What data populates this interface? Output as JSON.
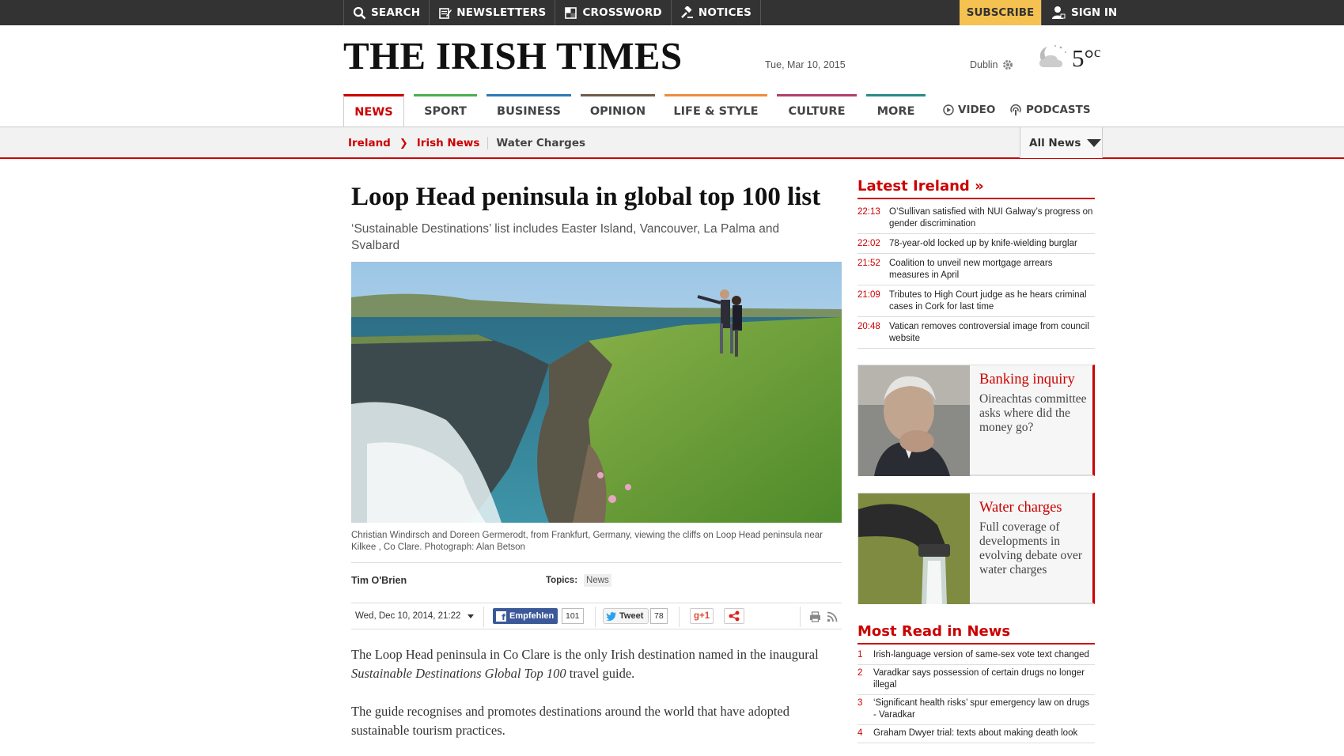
{
  "topbar": {
    "search": "SEARCH",
    "newsletters": "NEWSLETTERS",
    "crossword": "CROSSWORD",
    "notices": "NOTICES",
    "subscribe": "SUBSCRIBE",
    "signin": "SIGN IN"
  },
  "masthead": {
    "logo": "THE IRISH TIMES",
    "date": "Tue, Mar 10, 2015",
    "city": "Dublin",
    "temp": "5°",
    "temp_unit": "c"
  },
  "nav": {
    "sections": [
      {
        "label": "NEWS",
        "color": "#cc0000"
      },
      {
        "label": "SPORT",
        "color": "#4caf50"
      },
      {
        "label": "BUSINESS",
        "color": "#2b7bb9"
      },
      {
        "label": "OPINION",
        "color": "#6d5c4b"
      },
      {
        "label": "LIFE & STYLE",
        "color": "#f08c3c"
      },
      {
        "label": "CULTURE",
        "color": "#b0406e"
      },
      {
        "label": "MORE",
        "color": "#2a8a8a"
      }
    ],
    "video": "VIDEO",
    "podcasts": "PODCASTS"
  },
  "breadcrumb": {
    "level1": "Ireland",
    "level2": "Irish News",
    "current": "Water Charges",
    "all_news": "All News"
  },
  "article": {
    "headline": "Loop Head peninsula in global top 100 list",
    "standfirst": "‘Sustainable Destinations’ list includes Easter Island, Vancouver, La Palma and Svalbard",
    "caption": "Christian Windirsch and Doreen Germerodt, from Frankfurt, Germany, viewing the cliffs on Loop Head peninsula near Kilkee , Co Clare. Photograph: Alan Betson",
    "author": "Tim O'Brien",
    "topics_label": "Topics:",
    "topic": "News",
    "published": "Wed, Dec 10, 2014, 21:22",
    "fb_label": "Empfehlen",
    "fb_count": "101",
    "tweet_label": "Tweet",
    "tweet_count": "78",
    "gplus": "g+1",
    "para1_a": "The Loop Head peninsula in Co Clare is the only Irish destination named in the inaugural ",
    "para1_em": "Sustainable Destinations Global Top 100",
    "para1_b": " travel guide.",
    "para2": "The guide recognises and promotes destinations around the world that have adopted sustainable tourism practices."
  },
  "sidebar": {
    "latest_title": "Latest Ireland »",
    "latest": [
      {
        "time": "22:13",
        "text": "O’Sullivan satisfied with NUI Galway’s progress on gender discrimination"
      },
      {
        "time": "22:02",
        "text": "78-year-old locked up by knife-wielding burglar"
      },
      {
        "time": "21:52",
        "text": "Coalition to unveil new mortgage arrears measures in April"
      },
      {
        "time": "21:09",
        "text": "Tributes to High Court judge as he hears criminal cases in Cork for last time"
      },
      {
        "time": "20:48",
        "text": "Vatican removes controversial image from council website"
      }
    ],
    "promos": [
      {
        "title": "Banking inquiry",
        "desc": "Oireachtas committee asks where did the money go?"
      },
      {
        "title": "Water charges",
        "desc": "Full coverage of developments in evolving debate over water charges"
      }
    ],
    "most_title": "Most Read in News",
    "most": [
      {
        "n": "1",
        "text": "Irish-language version of same-sex vote text changed"
      },
      {
        "n": "2",
        "text": "Varadkar says possession of certain drugs no longer illegal"
      },
      {
        "n": "3",
        "text": "‘Significant health risks’ spur emergency law on drugs - Varadkar"
      },
      {
        "n": "4",
        "text": "Graham Dwyer trial: texts about making death look"
      }
    ]
  }
}
